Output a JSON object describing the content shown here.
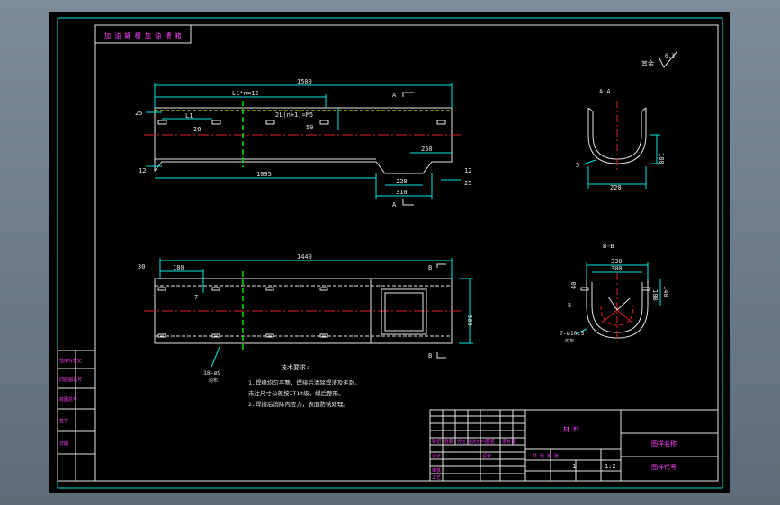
{
  "colors": {
    "window_bg": "#6f7f8c",
    "canvas_bg": "#000000",
    "border": "#00e5e5",
    "dimension": "#00e5e5",
    "center_line": "#e02020",
    "hidden_line": "#e6e6e6",
    "text": "#ff40ff",
    "accent_green": "#00e000",
    "weld": "#ffff00"
  },
  "top_label_box": {
    "line1": "加 油 罐 槽  加 油 槽 箱"
  },
  "front_view": {
    "total_length": "1500",
    "pitch_label": "L1*n=12",
    "left_offset": "25",
    "l1_label": "L1",
    "slot_width": "26",
    "hole_spec": "2L(n+1)=M5",
    "slot_spacing": "50",
    "step_label": "250",
    "left_height": "12",
    "right_height": "12",
    "bottom_length": "1095",
    "notch_top": "220",
    "notch_bottom": "310",
    "right_offset": "25",
    "section_mark_top": "A",
    "section_mark_bottom": "A"
  },
  "plan_view": {
    "total_length": "1440",
    "left_offset": "30",
    "first_pitch": "180",
    "small_dim": "7",
    "height": "300",
    "hole_callout": "18-ø9",
    "hole_sub": "均布",
    "section_mark_top": "B",
    "section_mark_bottom": "B"
  },
  "section_a": {
    "title": "A-A",
    "thickness": "5",
    "height": "180",
    "width": "220"
  },
  "section_b": {
    "title": "B-B",
    "outer_width": "330",
    "inner_width": "300",
    "left_dim": "40",
    "right_dim": "140",
    "depth": "100",
    "left_small": "5",
    "hole_callout": "7-ø10.5",
    "hole_sub": "均布"
  },
  "roughness": {
    "label": "其余",
    "value": "6.3"
  },
  "notes": {
    "title": "技术要求:",
    "lines": [
      "1.焊缝均匀平整，焊接后清除焊渣及毛刺。",
      "  未注尺寸公差按IT14级，焊后整形。",
      "2.焊接后消除内应力，表面防锈处理。"
    ]
  },
  "title_block": {
    "material": "材 料",
    "drawing_name": "图样名称",
    "drawing_no": "图样代号",
    "scale": "1:2",
    "quantity": "1",
    "design_label": "设计",
    "sheet_label": "共 张 第 张",
    "rev_headers": [
      "标记",
      "处数",
      "分区",
      "更改文件号",
      "签名",
      "年月日"
    ],
    "roles": [
      "设计",
      "审核",
      "工艺"
    ]
  },
  "side_column": [
    "借用件登记",
    "旧底图总号",
    "底图总号",
    "签字",
    "日期"
  ]
}
